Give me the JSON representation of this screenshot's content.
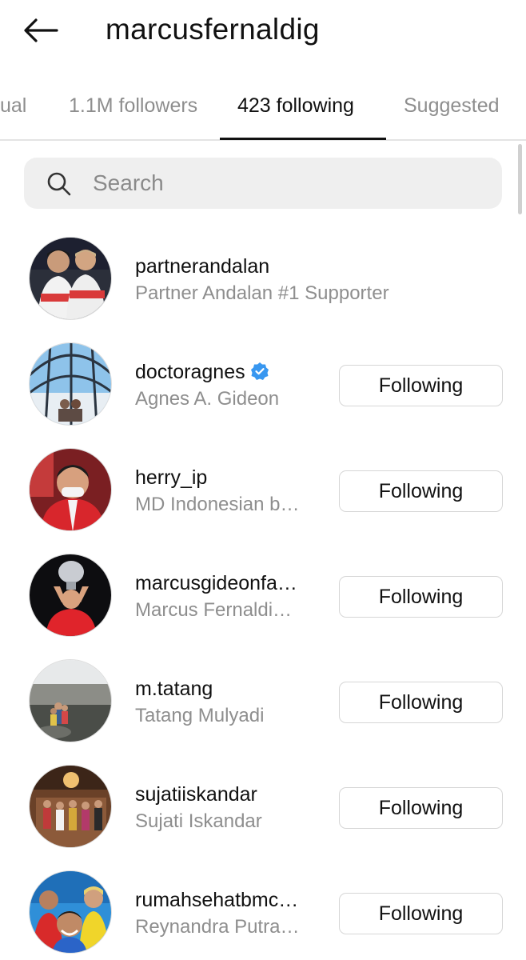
{
  "header": {
    "title": "marcusfernaldig"
  },
  "tabs": [
    {
      "label": "ual"
    },
    {
      "label": "1.1M followers"
    },
    {
      "label": "423 following"
    },
    {
      "label": "Suggested"
    }
  ],
  "search": {
    "placeholder": "Search"
  },
  "accounts": [
    {
      "username": "partnerandalan",
      "full_name": "Partner Andalan #1 Supporter",
      "verified": false,
      "button": ""
    },
    {
      "username": "doctoragnes",
      "full_name": "Agnes A. Gideon",
      "verified": true,
      "button": "Following"
    },
    {
      "username": "herry_ip",
      "full_name": "MD Indonesian b…",
      "verified": false,
      "button": "Following"
    },
    {
      "username": "marcusgideonfa…",
      "full_name": "Marcus Fernaldi…",
      "verified": false,
      "button": "Following"
    },
    {
      "username": "m.tatang",
      "full_name": "Tatang Mulyadi",
      "verified": false,
      "button": "Following"
    },
    {
      "username": "sujatiiskandar",
      "full_name": "Sujati Iskandar",
      "verified": false,
      "button": "Following"
    },
    {
      "username": "rumahsehatbmc…",
      "full_name": "Reynandra Putra…",
      "verified": false,
      "button": "Following"
    }
  ],
  "colors": {
    "verified_badge": "#3897f0",
    "secondary_text": "#8e8e8e",
    "button_border": "#d6d6d6"
  }
}
